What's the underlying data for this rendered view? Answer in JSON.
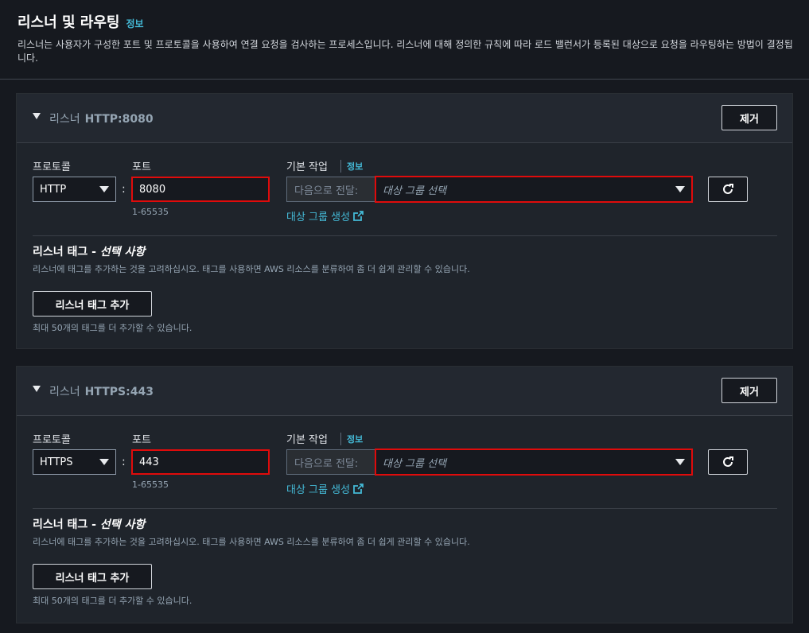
{
  "header": {
    "title": "리스너 및 라우팅",
    "info": "정보",
    "description": "리스너는 사용자가 구성한 포트 및 프로토콜을 사용하여 연결 요청을 검사하는 프로세스입니다. 리스너에 대해 정의한 규칙에 따라 로드 밸런서가 등록된 대상으로 요청을 라우팅하는 방법이 결정됩니다."
  },
  "listeners": [
    {
      "prefix": "리스너",
      "name": "HTTP:8080",
      "remove": "제거",
      "protocol_label": "프로토콜",
      "protocol_value": "HTTP",
      "port_label": "포트",
      "port_value": "8080",
      "port_hint": "1-65535",
      "action_label": "기본 작업",
      "action_info": "정보",
      "forward_label": "다음으로 전달:",
      "target_placeholder": "대상 그룹 선택",
      "create_target": "대상 그룹 생성",
      "tags_title": "리스너 태그 - ",
      "tags_optional": "선택 사항",
      "tags_desc": "리스너에 태그를 추가하는 것을 고려하십시오. 태그를 사용하면 AWS 리소스를 분류하여 좀 더 쉽게 관리할 수 있습니다.",
      "add_tag": "리스너 태그 추가",
      "tag_limit": "최대 50개의 태그를 더 추가할 수 있습니다."
    },
    {
      "prefix": "리스너",
      "name": "HTTPS:443",
      "remove": "제거",
      "protocol_label": "프로토콜",
      "protocol_value": "HTTPS",
      "port_label": "포트",
      "port_value": "443",
      "port_hint": "1-65535",
      "action_label": "기본 작업",
      "action_info": "정보",
      "forward_label": "다음으로 전달:",
      "target_placeholder": "대상 그룹 선택",
      "create_target": "대상 그룹 생성",
      "tags_title": "리스너 태그 - ",
      "tags_optional": "선택 사항",
      "tags_desc": "리스너에 태그를 추가하는 것을 고려하십시오. 태그를 사용하면 AWS 리소스를 분류하여 좀 더 쉽게 관리할 수 있습니다.",
      "add_tag": "리스너 태그 추가",
      "tag_limit": "최대 50개의 태그를 더 추가할 수 있습니다."
    }
  ],
  "icons": {
    "caret": "caret-down-icon",
    "dropdown": "triangle-down-icon",
    "refresh": "refresh-icon",
    "external": "external-link-icon"
  },
  "colors": {
    "accent_link": "#44b9d6",
    "highlight_border": "#e00b0b",
    "background": "#16191f"
  }
}
